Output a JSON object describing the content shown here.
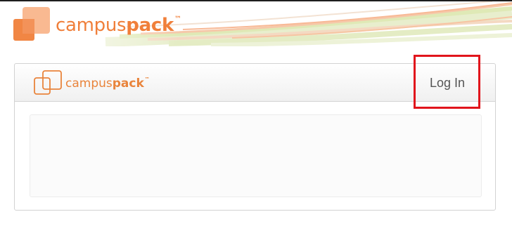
{
  "banner": {
    "logo_alt": "campuspack logo",
    "wordmark_regular": "campus",
    "wordmark_bold": "pack",
    "trademark": "™"
  },
  "card": {
    "logo_wordmark_regular": "campus",
    "logo_wordmark_bold": "pack",
    "logo_trademark": "™",
    "login_label": "Log In"
  },
  "colors": {
    "brand_orange": "#f07f3a",
    "highlight_red": "#e1151c"
  }
}
